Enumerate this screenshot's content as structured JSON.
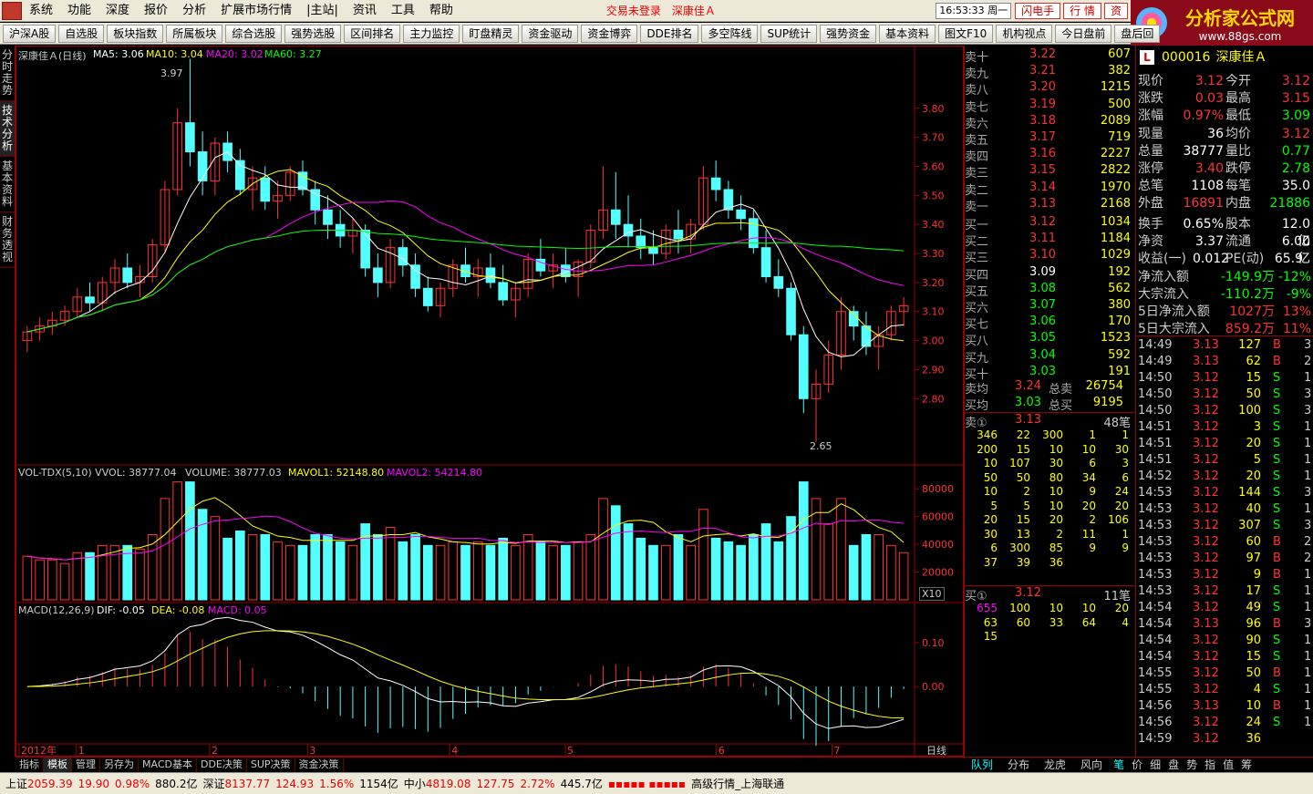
{
  "menubar": {
    "items": [
      "系统",
      "功能",
      "深度",
      "报价",
      "分析",
      "扩展市场行情",
      "|主站|",
      "资讯",
      "工具",
      "帮助"
    ],
    "login_warning": "交易未登录",
    "stock_tag": "深康佳Ａ",
    "clock": "16:53:33 周一",
    "btn_flash": "闪电手",
    "btn_quote": "行 情",
    "btn_finance": "资"
  },
  "brand": {
    "name": "分析家公式网",
    "url": "www.88gs.com"
  },
  "toolbar": {
    "buttons": [
      "沪深A股",
      "自选股",
      "板块指数",
      "所属板块",
      "综合选股",
      "强势选股",
      "区间排名",
      "主力监控",
      "盯盘精灵",
      "资金驱动",
      "资金博弈",
      "DDE排名",
      "多空阵线",
      "SUP统计",
      "强势资金",
      "基本资料",
      "图文F10",
      "机构视点",
      "今日盘前",
      "盘后回"
    ]
  },
  "left_tabs": [
    "分时走势",
    "技术分析",
    "基本资料",
    "财务透视"
  ],
  "kline": {
    "title": "深康佳Ａ(日线)",
    "ma5": "MA5: 3.06",
    "ma10": "MA10: 3.04",
    "ma20": "MA20: 3.02",
    "ma60": "MA60: 3.27",
    "high_mark": "3.97",
    "low_mark": "2.65",
    "y_ticks": [
      "3.80",
      "3.70",
      "3.60",
      "3.50",
      "3.40",
      "3.30",
      "3.20",
      "3.10",
      "3.00",
      "2.90",
      "2.80"
    ]
  },
  "volume": {
    "title": "VOL-TDX(5,10) VVOL: 38777.04",
    "vol": "VOLUME: 38777.03",
    "mavol1": "MAVOL1: 52148.80",
    "mavol2": "MAVOL2: 54214.80",
    "y_ticks": [
      "80000",
      "60000",
      "40000",
      "20000"
    ],
    "unit": "X10"
  },
  "macd": {
    "title": "MACD(12,26,9)",
    "dif": "DIF: -0.05",
    "dea": "DEA: -0.08",
    "macd": "MACD: 0.05",
    "y_ticks": [
      "0.10",
      "0.00"
    ]
  },
  "x_axis": {
    "labels": [
      "2012年",
      "1",
      "2",
      "3",
      "4",
      "5",
      "6",
      "7"
    ],
    "period": "日线"
  },
  "chart_data": {
    "type": "candlestick",
    "title": "深康佳Ａ(日线)",
    "period": "日线",
    "ylim": [
      2.6,
      3.95
    ],
    "ohlc": [
      [
        3.0,
        3.05,
        2.96,
        3.03
      ],
      [
        3.03,
        3.08,
        3.0,
        3.05
      ],
      [
        3.05,
        3.1,
        3.02,
        3.07
      ],
      [
        3.07,
        3.12,
        3.05,
        3.1
      ],
      [
        3.1,
        3.18,
        3.08,
        3.15
      ],
      [
        3.15,
        3.2,
        3.1,
        3.13
      ],
      [
        3.13,
        3.22,
        3.1,
        3.2
      ],
      [
        3.2,
        3.28,
        3.16,
        3.25
      ],
      [
        3.25,
        3.3,
        3.18,
        3.2
      ],
      [
        3.2,
        3.26,
        3.15,
        3.22
      ],
      [
        3.22,
        3.35,
        3.2,
        3.33
      ],
      [
        3.33,
        3.55,
        3.3,
        3.52
      ],
      [
        3.52,
        3.8,
        3.5,
        3.75
      ],
      [
        3.75,
        3.97,
        3.6,
        3.65
      ],
      [
        3.65,
        3.72,
        3.5,
        3.55
      ],
      [
        3.55,
        3.7,
        3.5,
        3.68
      ],
      [
        3.68,
        3.72,
        3.58,
        3.62
      ],
      [
        3.62,
        3.66,
        3.5,
        3.52
      ],
      [
        3.52,
        3.6,
        3.45,
        3.56
      ],
      [
        3.56,
        3.6,
        3.45,
        3.48
      ],
      [
        3.48,
        3.55,
        3.42,
        3.5
      ],
      [
        3.5,
        3.6,
        3.48,
        3.58
      ],
      [
        3.58,
        3.62,
        3.5,
        3.52
      ],
      [
        3.52,
        3.55,
        3.4,
        3.45
      ],
      [
        3.45,
        3.5,
        3.35,
        3.4
      ],
      [
        3.4,
        3.45,
        3.32,
        3.36
      ],
      [
        3.36,
        3.42,
        3.3,
        3.38
      ],
      [
        3.38,
        3.4,
        3.22,
        3.25
      ],
      [
        3.25,
        3.3,
        3.15,
        3.2
      ],
      [
        3.2,
        3.35,
        3.18,
        3.32
      ],
      [
        3.32,
        3.35,
        3.22,
        3.26
      ],
      [
        3.26,
        3.3,
        3.15,
        3.18
      ],
      [
        3.18,
        3.22,
        3.1,
        3.12
      ],
      [
        3.12,
        3.2,
        3.08,
        3.18
      ],
      [
        3.18,
        3.28,
        3.15,
        3.26
      ],
      [
        3.26,
        3.32,
        3.2,
        3.22
      ],
      [
        3.22,
        3.28,
        3.15,
        3.25
      ],
      [
        3.25,
        3.3,
        3.18,
        3.2
      ],
      [
        3.2,
        3.26,
        3.12,
        3.14
      ],
      [
        3.14,
        3.2,
        3.08,
        3.18
      ],
      [
        3.18,
        3.3,
        3.15,
        3.28
      ],
      [
        3.28,
        3.35,
        3.22,
        3.24
      ],
      [
        3.24,
        3.3,
        3.18,
        3.26
      ],
      [
        3.26,
        3.32,
        3.2,
        3.22
      ],
      [
        3.22,
        3.28,
        3.15,
        3.27
      ],
      [
        3.27,
        3.4,
        3.25,
        3.38
      ],
      [
        3.38,
        3.6,
        3.35,
        3.45
      ],
      [
        3.45,
        3.58,
        3.35,
        3.4
      ],
      [
        3.4,
        3.5,
        3.32,
        3.36
      ],
      [
        3.36,
        3.42,
        3.28,
        3.32
      ],
      [
        3.32,
        3.38,
        3.26,
        3.3
      ],
      [
        3.3,
        3.4,
        3.28,
        3.38
      ],
      [
        3.38,
        3.45,
        3.3,
        3.35
      ],
      [
        3.35,
        3.42,
        3.3,
        3.4
      ],
      [
        3.4,
        3.6,
        3.38,
        3.56
      ],
      [
        3.56,
        3.62,
        3.48,
        3.52
      ],
      [
        3.52,
        3.55,
        3.42,
        3.45
      ],
      [
        3.45,
        3.5,
        3.38,
        3.42
      ],
      [
        3.42,
        3.45,
        3.3,
        3.32
      ],
      [
        3.32,
        3.38,
        3.2,
        3.22
      ],
      [
        3.22,
        3.28,
        3.15,
        3.18
      ],
      [
        3.18,
        3.2,
        3.0,
        3.02
      ],
      [
        3.02,
        3.05,
        2.75,
        2.8
      ],
      [
        2.8,
        2.9,
        2.65,
        2.85
      ],
      [
        2.85,
        3.0,
        2.82,
        2.95
      ],
      [
        2.95,
        3.15,
        2.9,
        3.1
      ],
      [
        3.1,
        3.12,
        3.0,
        3.05
      ],
      [
        3.05,
        3.1,
        2.95,
        2.98
      ],
      [
        2.98,
        3.05,
        2.9,
        3.02
      ],
      [
        3.02,
        3.12,
        3.0,
        3.1
      ],
      [
        3.1,
        3.15,
        3.05,
        3.12
      ]
    ]
  },
  "quote_book": {
    "asks": [
      [
        "卖十",
        "3.22",
        "607"
      ],
      [
        "卖九",
        "3.21",
        "382"
      ],
      [
        "卖八",
        "3.20",
        "1215"
      ],
      [
        "卖七",
        "3.19",
        "500"
      ],
      [
        "卖六",
        "3.18",
        "2089"
      ],
      [
        "卖五",
        "3.17",
        "719"
      ],
      [
        "卖四",
        "3.16",
        "2227"
      ],
      [
        "卖三",
        "3.15",
        "2822"
      ],
      [
        "卖二",
        "3.14",
        "1970"
      ],
      [
        "卖一",
        "3.13",
        "2168"
      ]
    ],
    "bids": [
      [
        "买一",
        "3.12",
        "1034"
      ],
      [
        "买二",
        "3.11",
        "1184"
      ],
      [
        "买三",
        "3.10",
        "1029"
      ],
      [
        "买四",
        "3.09",
        "192"
      ],
      [
        "买五",
        "3.08",
        "562"
      ],
      [
        "买六",
        "3.07",
        "380"
      ],
      [
        "买七",
        "3.06",
        "170"
      ],
      [
        "买八",
        "3.05",
        "1523"
      ],
      [
        "买九",
        "3.04",
        "592"
      ],
      [
        "买十",
        "3.03",
        "191"
      ]
    ],
    "ask_avg": [
      "卖均",
      "3.24",
      "总卖",
      "26754"
    ],
    "bid_avg": [
      "买均",
      "3.03",
      "总买",
      "9195"
    ],
    "sell1_head": [
      "卖①",
      "3.13",
      "48笔"
    ],
    "sell1_queue": [
      [
        "346",
        "22",
        "300",
        "1",
        "1"
      ],
      [
        "200",
        "15",
        "10",
        "10",
        "30"
      ],
      [
        "10",
        "107",
        "30",
        "6",
        "3"
      ],
      [
        "50",
        "50",
        "80",
        "34",
        "6"
      ],
      [
        "10",
        "2",
        "10",
        "9",
        "24"
      ],
      [
        "5",
        "5",
        "10",
        "20",
        "20"
      ],
      [
        "20",
        "15",
        "20",
        "2",
        "106"
      ],
      [
        "30",
        "13",
        "2",
        "11",
        "1"
      ],
      [
        "6",
        "300",
        "85",
        "9",
        "9"
      ],
      [
        "37",
        "39",
        "36",
        "",
        ""
      ]
    ],
    "buy1_head": [
      "买①",
      "3.12",
      "11笔"
    ],
    "buy1_queue": [
      [
        "655",
        "100",
        "10",
        "10",
        "20"
      ],
      [
        "63",
        "60",
        "33",
        "64",
        "4"
      ],
      [
        "15",
        "",
        "",
        "",
        ""
      ]
    ]
  },
  "info_panel": {
    "code": "000016",
    "name": "深康佳Ａ",
    "rows": [
      [
        "现价",
        "3.12",
        "今开",
        "3.12"
      ],
      [
        "涨跌",
        "0.03",
        "最高",
        "3.15"
      ],
      [
        "涨幅",
        "0.97%",
        "最低",
        "3.09"
      ],
      [
        "现量",
        "36",
        "均价",
        "3.12"
      ],
      [
        "总量",
        "38777",
        "量比",
        "0.77"
      ],
      [
        "涨停",
        "3.40",
        "跌停",
        "2.78"
      ],
      [
        "总笔",
        "1108",
        "每笔",
        "35.0"
      ],
      [
        "外盘",
        "16891",
        "内盘",
        "21886"
      ],
      [
        "换手",
        "0.65%",
        "股本",
        "12.0亿"
      ],
      [
        "净资",
        "3.37",
        "流通",
        "6.00亿"
      ],
      [
        "收益(一)",
        "0.012",
        "PE(动)",
        "65.9"
      ]
    ],
    "flows": [
      [
        "净流入额",
        "-149.9万",
        "-12%"
      ],
      [
        "大宗流入",
        "-110.2万",
        "-9%"
      ],
      [
        "5日净流入额",
        "1027万",
        "13%"
      ],
      [
        "5日大宗流入",
        "859.2万",
        "11%"
      ]
    ],
    "ticks": [
      [
        "14:49",
        "3.13",
        "127",
        "B",
        "3"
      ],
      [
        "14:49",
        "3.13",
        "62",
        "B",
        "2"
      ],
      [
        "14:50",
        "3.12",
        "15",
        "S",
        "1"
      ],
      [
        "14:50",
        "3.12",
        "50",
        "S",
        "3"
      ],
      [
        "14:50",
        "3.12",
        "100",
        "S",
        "3"
      ],
      [
        "14:51",
        "3.12",
        "3",
        "S",
        "1"
      ],
      [
        "14:51",
        "3.12",
        "20",
        "S",
        "1"
      ],
      [
        "14:51",
        "3.12",
        "5",
        "S",
        "1"
      ],
      [
        "14:52",
        "3.12",
        "20",
        "S",
        "1"
      ],
      [
        "14:53",
        "3.12",
        "144",
        "S",
        "3"
      ],
      [
        "14:53",
        "3.12",
        "40",
        "S",
        "1"
      ],
      [
        "14:53",
        "3.12",
        "307",
        "S",
        "3"
      ],
      [
        "14:53",
        "3.12",
        "60",
        "B",
        "2"
      ],
      [
        "14:53",
        "3.12",
        "97",
        "B",
        "2"
      ],
      [
        "14:53",
        "3.12",
        "9",
        "B",
        "1"
      ],
      [
        "14:53",
        "3.12",
        "17",
        "S",
        "1"
      ],
      [
        "14:54",
        "3.12",
        "49",
        "S",
        "1"
      ],
      [
        "14:54",
        "3.13",
        "96",
        "B",
        "3"
      ],
      [
        "14:54",
        "3.12",
        "90",
        "S",
        "1"
      ],
      [
        "14:54",
        "3.12",
        "15",
        "S",
        "1"
      ],
      [
        "14:55",
        "3.12",
        "50",
        "B",
        "1"
      ],
      [
        "14:55",
        "3.12",
        "4",
        "S",
        "1"
      ],
      [
        "14:56",
        "3.13",
        "10",
        "B",
        "1"
      ],
      [
        "14:56",
        "3.12",
        "24",
        "S",
        "1"
      ],
      [
        "14:59",
        "3.12",
        "36",
        "",
        ""
      ]
    ]
  },
  "bottom_tabs": [
    "指标",
    "模板",
    "管理",
    "另存为",
    "MACD基本",
    "DDE决策",
    "SUP决策",
    "资金决策"
  ],
  "right_tabs": [
    "队列",
    "分布",
    "龙虎",
    "风向",
    "笔",
    "价",
    "细",
    "盘",
    "势",
    "指",
    "值",
    "筹"
  ],
  "statusbar": {
    "sh_name": "上证",
    "sh_val": "2059.39",
    "sh_chg": "19.90",
    "sh_pct": "0.98%",
    "sh_amt": "880.2亿",
    "sz_name": "深证",
    "sz_val": "8137.77",
    "sz_chg": "124.93",
    "sz_pct": "1.56%",
    "sz_amt": "1154亿",
    "zx_name": "中小",
    "zx_val": "4819.08",
    "zx_chg": "127.75",
    "zx_pct": "2.72%",
    "zx_amt": "445.7亿",
    "feed": "高级行情_上海联通"
  },
  "colors": {
    "up": "#ff3232",
    "down": "#54ffff",
    "ma5": "#ffffff",
    "ma10": "#ffff00",
    "ma20": "#ff00ff",
    "ma60": "#00ff00"
  }
}
